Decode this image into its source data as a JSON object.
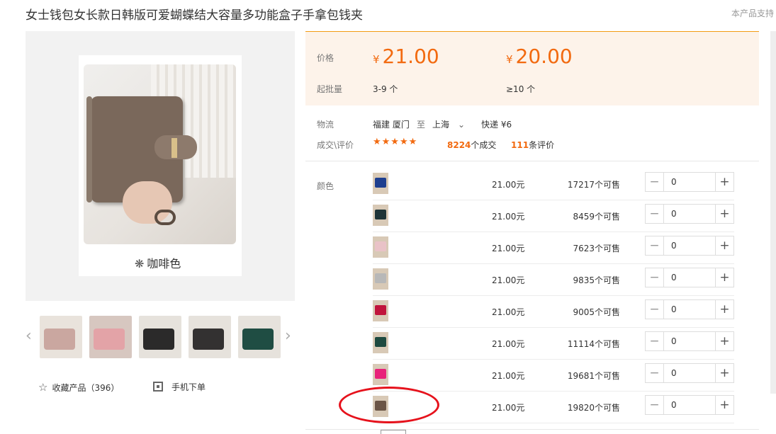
{
  "title": "女士钱包女长款日韩版可爱蝴蝶结大容量多功能盒子手拿包钱夹",
  "support_text": "本产品支持",
  "gallery": {
    "selected_color_caption": "咖啡色",
    "thumbnails": [
      "pink-wallet",
      "pink-open-wallet",
      "black-wallet",
      "black-wallet-2",
      "green-wallet"
    ],
    "thumb_colors": [
      "#caa7a0",
      "#e3a3a7",
      "#2b2a2a",
      "#333131",
      "#1f4d43"
    ]
  },
  "favorite": {
    "label": "收藏产品",
    "count": "（396）"
  },
  "mobile_order": "手机下单",
  "price": {
    "price_label": "价格",
    "currency": "¥",
    "tier1_price": "21.00",
    "tier2_price": "20.00",
    "moq_label": "起批量",
    "tier1_qty": "3-9 个",
    "tier2_qty": "≥10 个"
  },
  "logistics": {
    "label": "物流",
    "from": "福建 厦门",
    "to_word": "至",
    "to": "上海",
    "shipping": "快递 ¥6"
  },
  "deals": {
    "label": "成交\\评价",
    "stars": "★★★★★",
    "deal_count": "8224",
    "deal_suffix": "个成交",
    "review_count": "111",
    "review_suffix": "条评价"
  },
  "variants": {
    "label": "颜色",
    "rows": [
      {
        "swatch_color": "#1e3f8f",
        "price": "21.00元",
        "stock": "17217个可售",
        "qty": "0"
      },
      {
        "swatch_color": "#1f3538",
        "price": "21.00元",
        "stock": "8459个可售",
        "qty": "0"
      },
      {
        "swatch_color": "#e9c2c7",
        "price": "21.00元",
        "stock": "7623个可售",
        "qty": "0"
      },
      {
        "swatch_color": "#b8b8b8",
        "price": "21.00元",
        "stock": "9835个可售",
        "qty": "0"
      },
      {
        "swatch_color": "#c0143c",
        "price": "21.00元",
        "stock": "9005个可售",
        "qty": "0"
      },
      {
        "swatch_color": "#1e4a40",
        "price": "21.00元",
        "stock": "11114个可售",
        "qty": "0"
      },
      {
        "swatch_color": "#e8237a",
        "price": "21.00元",
        "stock": "19681个可售",
        "qty": "0"
      },
      {
        "swatch_color": "#6b5546",
        "price": "21.00元",
        "stock": "19820个可售",
        "qty": "0"
      }
    ],
    "minus": "−",
    "plus": "+"
  },
  "icons": {
    "prev": "chevron-left-icon",
    "next": "chevron-right-icon",
    "star": "star-outline-icon",
    "qr": "qr-code-icon",
    "dropdown": "chevron-down-icon"
  },
  "accent_color": "#f26a10",
  "annotation_color": "#e6121c"
}
